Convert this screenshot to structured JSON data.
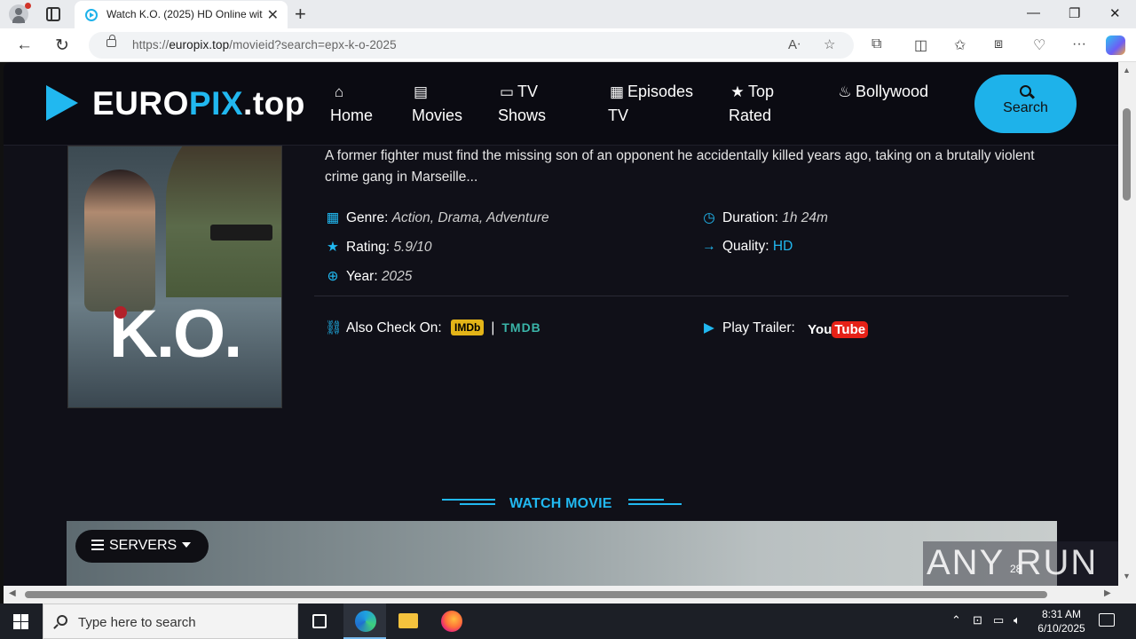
{
  "browser": {
    "tab_title": "Watch K.O. (2025) HD Online wit",
    "tab_close": "✕",
    "new_tab": "+",
    "url_prefix": "https://",
    "url_domain": "europix.top",
    "url_path": "/movieid?search=epx-k-o-2025",
    "window_minimize": "—",
    "window_restore": "❐",
    "window_close": "✕"
  },
  "site": {
    "logo_main": "EURO",
    "logo_pix": "PIX",
    "logo_tld": ".top",
    "nav": [
      {
        "icon": "⌂",
        "line1": "Home",
        "line2": ""
      },
      {
        "icon": "▤",
        "line1": "Movies",
        "line2": ""
      },
      {
        "icon": "▭",
        "line1": "TV",
        "line2": "Shows"
      },
      {
        "icon": "▦",
        "line1": "Episodes",
        "line2": "TV"
      },
      {
        "icon": "★",
        "line1": "Top",
        "line2": "Rated"
      },
      {
        "icon": "♨",
        "line1": "Bollywood",
        "line2": ""
      }
    ],
    "search_label": "Search"
  },
  "movie": {
    "poster_title": "K.O.",
    "description": "A former fighter must find the missing son of an opponent he accidentally killed years ago, taking on a brutally violent crime gang in Marseille...",
    "genre_label": "Genre:",
    "genre": "Action, Drama, Adventure",
    "rating_label": "Rating:",
    "rating": "5.9/10",
    "year_label": "Year:",
    "year": "2025",
    "duration_label": "Duration:",
    "duration": "1h 24m",
    "quality_label": "Quality:",
    "quality": "HD",
    "also_check_label": "Also Check On:",
    "imdb": "IMDb",
    "separator": "|",
    "tmdb": "TMDB",
    "trailer_label": "Play Trailer:",
    "youtube_you": "You",
    "youtube_tube": "Tube"
  },
  "player": {
    "section_title": "WATCH MOVIE",
    "servers_label": "SERVERS",
    "watermark": "ANY RUN",
    "watermark_count": "28"
  },
  "taskbar": {
    "search_placeholder": "Type here to search",
    "time": "8:31 AM",
    "date": "6/10/2025"
  }
}
